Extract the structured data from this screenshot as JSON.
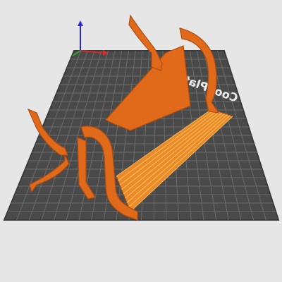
{
  "viewport": {
    "background": "#e6e6e6",
    "plate_color": "#4a4a4a",
    "grid_color": "#6f6f6f",
    "model_color": "#e06a1a",
    "model_highlight": "#f2a43a"
  },
  "plate": {
    "label": "Cool Plate",
    "label_reversed": true
  },
  "axes": {
    "x_color": "#d42a2a",
    "y_color": "#2aa52a",
    "z_color": "#2a2ad4"
  },
  "model": {
    "object": "bench"
  }
}
